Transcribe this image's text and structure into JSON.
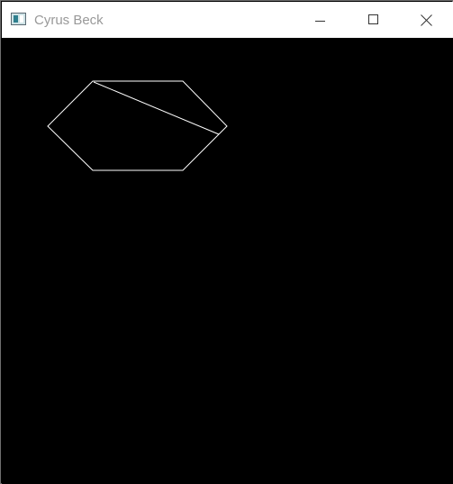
{
  "window": {
    "title": "Cyrus Beck",
    "icon": "app-window-icon",
    "controls": {
      "minimize_icon": "minimize-icon",
      "maximize_icon": "maximize-icon",
      "close_icon": "close-icon"
    }
  },
  "canvas": {
    "background_color": "#000000",
    "stroke_color": "#ffffff",
    "shapes": [
      "clipping-hexagon",
      "clipped-line"
    ]
  }
}
